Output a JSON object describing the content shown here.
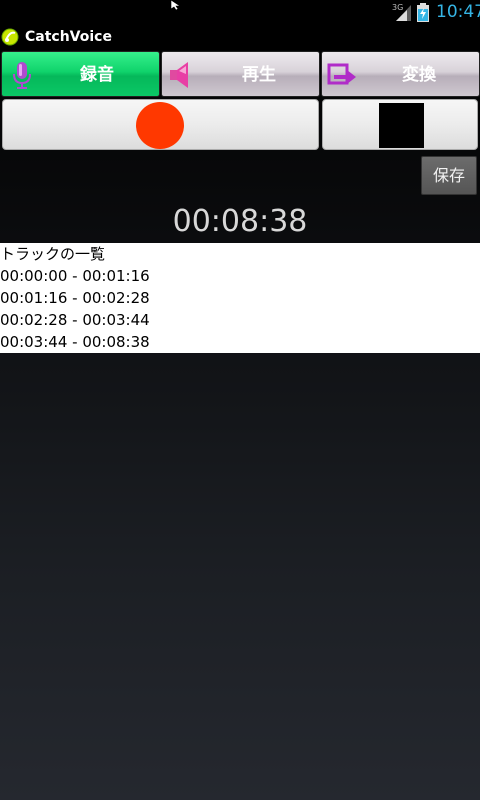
{
  "status_bar": {
    "network_label": "3G",
    "time": "10:47"
  },
  "app": {
    "title": "CatchVoice"
  },
  "mode_buttons": [
    {
      "label": "録音",
      "icon": "microphone-icon",
      "active": true
    },
    {
      "label": "再生",
      "icon": "speaker-icon",
      "active": false
    },
    {
      "label": "変換",
      "icon": "convert-arrow-icon",
      "active": false
    }
  ],
  "controls": {
    "record_icon": "record-circle-icon",
    "stop_icon": "stop-square-icon",
    "save_label": "保存"
  },
  "timer": "00:08:38",
  "track_list": {
    "title": "トラックの一覧",
    "items": [
      "00:00:00 - 00:01:16",
      "00:01:16 - 00:02:28",
      "00:02:28 - 00:03:44",
      "00:03:44 - 00:08:38"
    ]
  },
  "colors": {
    "accent_green": "#0fd36b",
    "record_red": "#ff3800",
    "clock_blue": "#35b5e5"
  }
}
